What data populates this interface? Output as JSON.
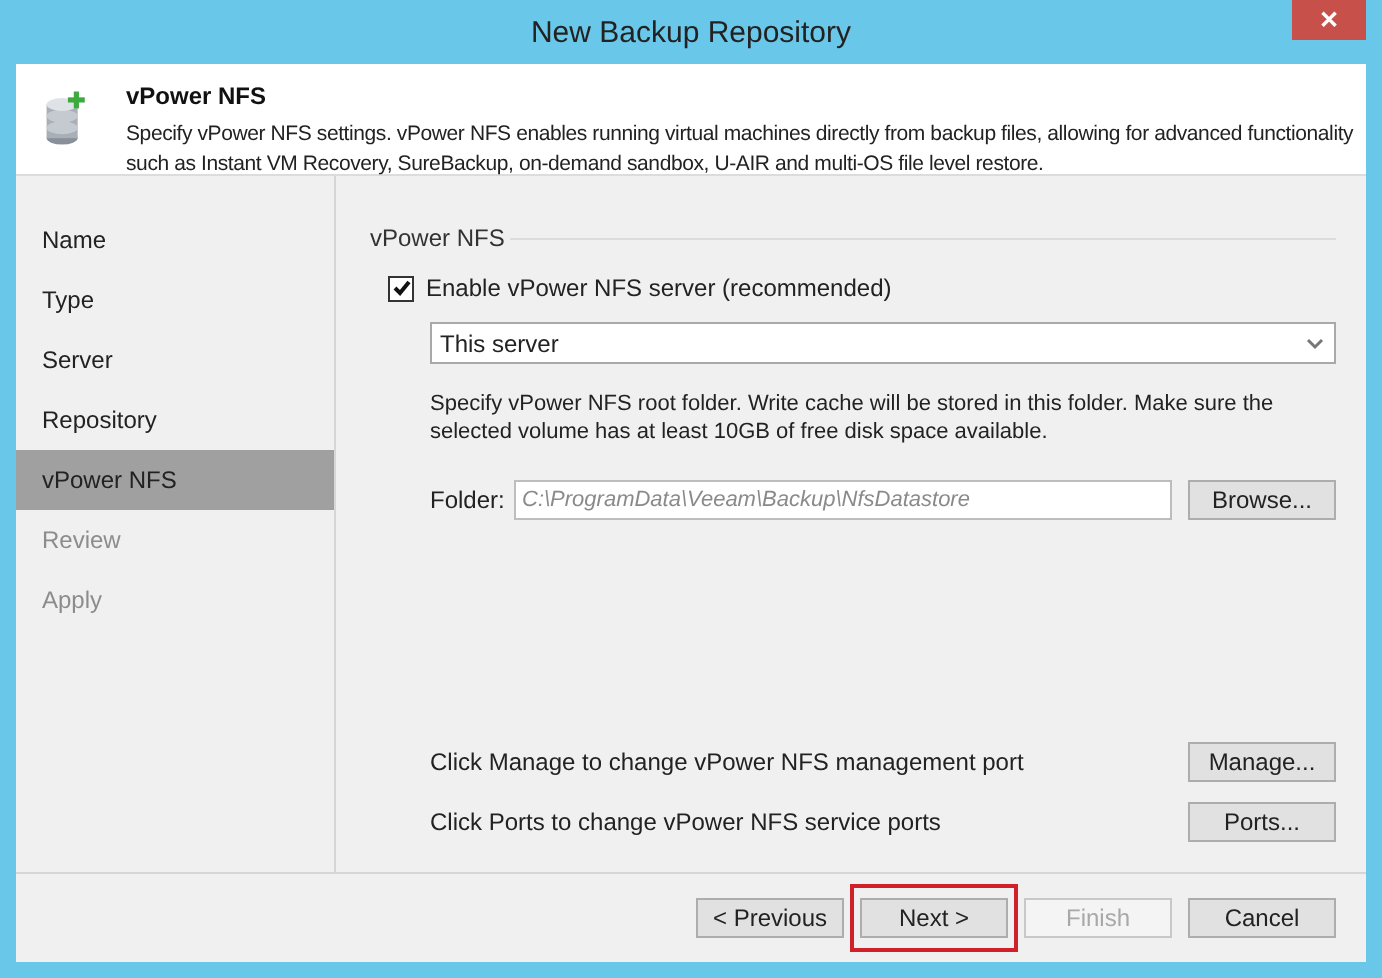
{
  "window": {
    "title": "New Backup Repository",
    "close_label": "✕"
  },
  "header": {
    "title": "vPower NFS",
    "description": "Specify vPower NFS settings. vPower NFS enables running virtual machines directly from backup files, allowing for advanced functionality such as Instant VM Recovery, SureBackup, on-demand sandbox, U-AIR and multi-OS file level restore."
  },
  "steps": [
    {
      "label": "Name",
      "selected": false,
      "disabled": false
    },
    {
      "label": "Type",
      "selected": false,
      "disabled": false
    },
    {
      "label": "Server",
      "selected": false,
      "disabled": false
    },
    {
      "label": "Repository",
      "selected": false,
      "disabled": false
    },
    {
      "label": "vPower NFS",
      "selected": true,
      "disabled": false
    },
    {
      "label": "Review",
      "selected": false,
      "disabled": true
    },
    {
      "label": "Apply",
      "selected": false,
      "disabled": true
    }
  ],
  "group_title": "vPower NFS",
  "enable_checkbox": {
    "label": "Enable vPower NFS server (recommended)",
    "checked": true
  },
  "server_select": {
    "value": "This server"
  },
  "folder_hint": "Specify vPower NFS root folder. Write cache will be stored in this folder. Make sure the selected volume has at least 10GB of free disk space available.",
  "folder": {
    "label": "Folder:",
    "value": "C:\\ProgramData\\Veeam\\Backup\\NfsDatastore",
    "button": "Browse..."
  },
  "port_rows": [
    {
      "text": "Click Manage to change vPower NFS management port",
      "button": "Manage..."
    },
    {
      "text": "Click Ports to change vPower NFS service ports",
      "button": "Ports..."
    }
  ],
  "footer_buttons": [
    {
      "label": "< Previous",
      "disabled": false,
      "highlighted": false
    },
    {
      "label": "Next >",
      "disabled": false,
      "highlighted": true
    },
    {
      "label": "Finish",
      "disabled": true,
      "highlighted": false
    },
    {
      "label": "Cancel",
      "disabled": false,
      "highlighted": false
    }
  ]
}
